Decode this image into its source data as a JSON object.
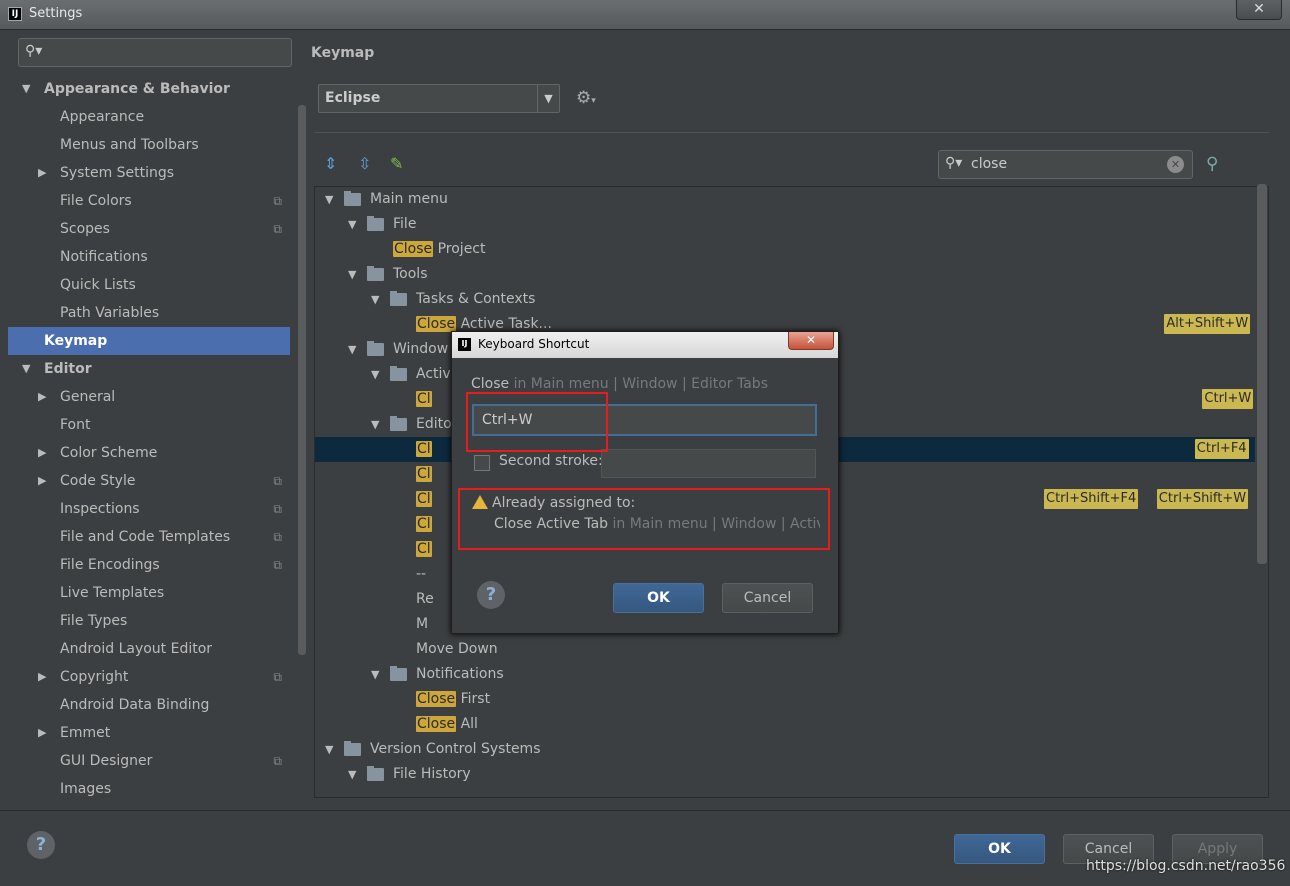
{
  "window": {
    "title": "Settings",
    "close_label": "✕"
  },
  "sidebar": {
    "search_value": "",
    "items": [
      {
        "label": "Appearance & Behavior",
        "level": 0,
        "expand": "open",
        "bold": true
      },
      {
        "label": "Appearance",
        "level": 1
      },
      {
        "label": "Menus and Toolbars",
        "level": 1
      },
      {
        "label": "System Settings",
        "level": 1,
        "expand": "closed"
      },
      {
        "label": "File Colors",
        "level": 1,
        "copy": true
      },
      {
        "label": "Scopes",
        "level": 1,
        "copy": true
      },
      {
        "label": "Notifications",
        "level": 1
      },
      {
        "label": "Quick Lists",
        "level": 1
      },
      {
        "label": "Path Variables",
        "level": 1
      },
      {
        "label": "Keymap",
        "level": 0,
        "bold": true,
        "selected": true
      },
      {
        "label": "Editor",
        "level": 0,
        "expand": "open",
        "bold": true
      },
      {
        "label": "General",
        "level": 1,
        "expand": "closed"
      },
      {
        "label": "Font",
        "level": 1
      },
      {
        "label": "Color Scheme",
        "level": 1,
        "expand": "closed"
      },
      {
        "label": "Code Style",
        "level": 1,
        "expand": "closed",
        "copy": true
      },
      {
        "label": "Inspections",
        "level": 1,
        "copy": true
      },
      {
        "label": "File and Code Templates",
        "level": 1,
        "copy": true
      },
      {
        "label": "File Encodings",
        "level": 1,
        "copy": true
      },
      {
        "label": "Live Templates",
        "level": 1
      },
      {
        "label": "File Types",
        "level": 1
      },
      {
        "label": "Android Layout Editor",
        "level": 1
      },
      {
        "label": "Copyright",
        "level": 1,
        "expand": "closed",
        "copy": true
      },
      {
        "label": "Android Data Binding",
        "level": 1
      },
      {
        "label": "Emmet",
        "level": 1,
        "expand": "closed"
      },
      {
        "label": "GUI Designer",
        "level": 1,
        "copy": true
      },
      {
        "label": "Images",
        "level": 1
      }
    ]
  },
  "keymap": {
    "heading": "Keymap",
    "scheme": "Eclipse",
    "filter_value": "close",
    "tree": [
      {
        "level": 0,
        "expand": "open",
        "icon": "menu",
        "pre": "",
        "hl": "",
        "post": "Main menu"
      },
      {
        "level": 1,
        "expand": "open",
        "icon": "folder",
        "pre": "",
        "hl": "",
        "post": "File"
      },
      {
        "level": 2,
        "pre": "",
        "hl": "Close",
        "post": " Project"
      },
      {
        "level": 1,
        "expand": "open",
        "icon": "folder",
        "pre": "",
        "hl": "",
        "post": "Tools"
      },
      {
        "level": 2,
        "expand": "open",
        "icon": "folder",
        "pre": "",
        "hl": "",
        "post": "Tasks & Contexts"
      },
      {
        "level": 3,
        "pre": "",
        "hl": "Close",
        "post": " Active Task...",
        "keys": [
          "Alt+Shift+W"
        ]
      },
      {
        "level": 1,
        "expand": "open",
        "icon": "folder",
        "pre": "",
        "hl": "",
        "post": "Window"
      },
      {
        "level": 2,
        "expand": "open",
        "icon": "folder",
        "pre": "",
        "hl": "",
        "post": "Active"
      },
      {
        "level": 3,
        "pre": "",
        "hl": "Cl",
        "post": "",
        "keys": [
          "Ctrl+W"
        ]
      },
      {
        "level": 2,
        "expand": "open",
        "icon": "folder",
        "pre": "",
        "hl": "",
        "post": "Editor"
      },
      {
        "level": 3,
        "pre": "",
        "hl": "Cl",
        "post": "",
        "keys": [
          "Ctrl+F4"
        ],
        "selected": true
      },
      {
        "level": 3,
        "pre": "",
        "hl": "Cl",
        "post": ""
      },
      {
        "level": 3,
        "pre": "",
        "hl": "Cl",
        "post": "",
        "keys": [
          "Ctrl+Shift+F4",
          "Ctrl+Shift+W"
        ]
      },
      {
        "level": 3,
        "pre": "",
        "hl": "Cl",
        "post": ""
      },
      {
        "level": 3,
        "pre": "",
        "hl": "Cl",
        "post": ""
      },
      {
        "level": 3,
        "pre": "",
        "hl": "",
        "post": "--"
      },
      {
        "level": 3,
        "pre": "",
        "hl": "",
        "post": "Re"
      },
      {
        "level": 3,
        "pre": "",
        "hl": "",
        "post": "M"
      },
      {
        "level": 3,
        "pre": "",
        "hl": "",
        "post": "Move Down"
      },
      {
        "level": 2,
        "expand": "open",
        "icon": "folder",
        "pre": "",
        "hl": "",
        "post": "Notifications"
      },
      {
        "level": 3,
        "pre": "",
        "hl": "Close",
        "post": " First"
      },
      {
        "level": 3,
        "pre": "",
        "hl": "Close",
        "post": " All"
      },
      {
        "level": 0,
        "expand": "open",
        "icon": "folder",
        "pre": "",
        "hl": "",
        "post": "Version Control Systems"
      },
      {
        "level": 1,
        "expand": "open",
        "icon": "folder",
        "pre": "",
        "hl": "",
        "post": "File History"
      }
    ]
  },
  "dialog": {
    "title": "Keyboard Shortcut",
    "action": "Close",
    "action_path": " in Main menu | Window | Editor Tabs",
    "first_stroke": "Ctrl+W",
    "second_stroke_label": "Second stroke:",
    "warning_title": "Already assigned to:",
    "conflict_action": "Close Active Tab",
    "conflict_path": " in Main menu | Window | Active",
    "ok_label": "OK",
    "cancel_label": "Cancel",
    "help_label": "?"
  },
  "footer": {
    "ok_label": "OK",
    "cancel_label": "Cancel",
    "apply_label": "Apply",
    "help_label": "?"
  },
  "watermark": "https://blog.csdn.net/rao356",
  "colors": {
    "accent": "#4b6eaf",
    "highlight": "#cda73a",
    "warning": "#e5b53c",
    "annotation": "#e81c1c"
  }
}
